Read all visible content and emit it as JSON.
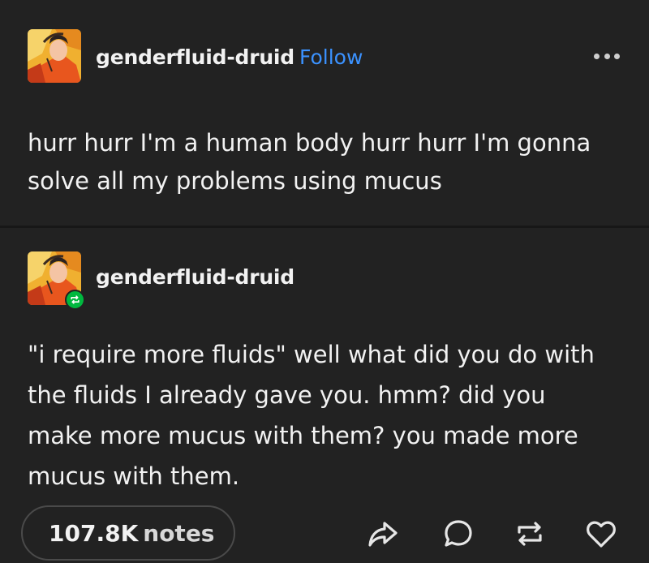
{
  "original_post": {
    "username": "genderfluid-druid",
    "follow_label": "Follow",
    "text": "hurr hurr I'm a human body hurr hurr I'm gonna\nsolve all my problems using mucus"
  },
  "reblog": {
    "username": "genderfluid-druid",
    "text": "\"i require more fluids\" well what did you do with\nthe fluids I already gave you. hmm? did you\nmake more mucus with them? you made more\nmucus with them."
  },
  "footer": {
    "notes_count": "107.8K",
    "notes_label": "notes"
  },
  "icons": {
    "more": "more-horizontal-icon",
    "share": "share-icon",
    "reply": "reply-icon",
    "reblog": "reblog-icon",
    "like": "heart-icon"
  },
  "colors": {
    "background": "#222222",
    "follow_link": "#3b92ff",
    "reblog_badge": "#00b83f"
  }
}
